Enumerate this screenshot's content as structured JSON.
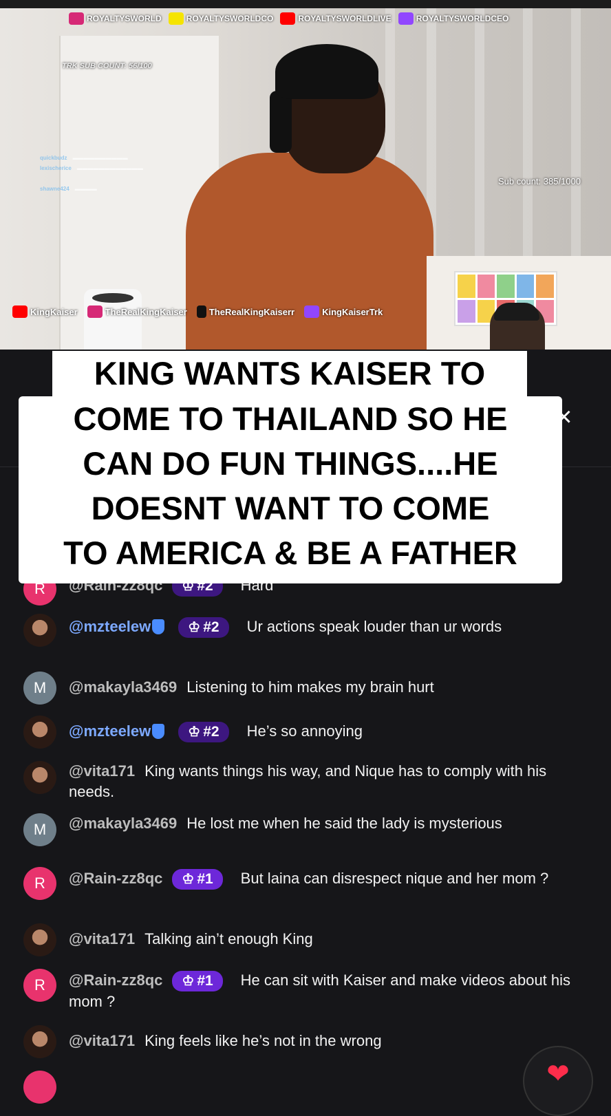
{
  "video": {
    "top_socials": [
      {
        "name": "ROYALTYSWORLD",
        "icon": "instagram-icon",
        "color": "#d62976"
      },
      {
        "name": "ROYALTYSWORLDCO",
        "icon": "snapchat-icon",
        "color": "#f5e400"
      },
      {
        "name": "ROYALTYSWORLDLIVE",
        "icon": "youtube-icon",
        "color": "#ff0000"
      },
      {
        "name": "ROYALTYSWORLDCEO",
        "icon": "twitch-icon",
        "color": "#9146ff"
      }
    ],
    "trk_sub_count": "TRK SUB COUNT: 56/100",
    "sub_count": "Sub count: 385/1000",
    "overlay_chat_users": [
      "quickbudz",
      "lexischerice",
      "shawne424"
    ],
    "bottom_socials": [
      {
        "name": "KingKaiser",
        "icon": "youtube-icon",
        "color": "#ff0000"
      },
      {
        "name": "TheRealKingKaiser",
        "icon": "instagram-icon",
        "color": "#d62976"
      },
      {
        "name": "TheRealKingKaiserr",
        "icon": "tiktok-icon",
        "color": "#000000"
      },
      {
        "name": "KingKaiserTrk",
        "icon": "twitch-icon",
        "color": "#9146ff"
      }
    ]
  },
  "close_icon": "×",
  "caption": {
    "line1": "KING WANTS KAISER TO",
    "lines": [
      "COME TO THAILAND SO HE",
      "CAN DO FUN THINGS....HE",
      "DOESNT WANT TO COME",
      "TO AMERICA & BE A FATHER"
    ]
  },
  "comments": [
    {
      "user": "@Rain-zz8qc",
      "avatar": "R",
      "badge": "#2",
      "text": "Hard"
    },
    {
      "user": "@mzteelew",
      "avatar": "photo",
      "verified": true,
      "badge": "#2",
      "text": "Ur actions speak louder than ur words"
    },
    {
      "user": "@makayla3469",
      "avatar": "M",
      "text": "Listening to him makes my brain hurt"
    },
    {
      "user": "@mzteelew",
      "avatar": "photo",
      "verified": true,
      "badge": "#2",
      "text": "He’s so annoying"
    },
    {
      "user": "@vita171",
      "avatar": "photo",
      "text": "King wants things his way, and Nique has to comply with his needs."
    },
    {
      "user": "@makayla3469",
      "avatar": "M",
      "text": "He lost me when he said the lady is mysterious"
    },
    {
      "user": "@Rain-zz8qc",
      "avatar": "R",
      "badge": "#1",
      "text": "But laina can disrespect nique and her mom ?"
    },
    {
      "user": "@vita171",
      "avatar": "photo",
      "text": "Talking ain’t enough King"
    },
    {
      "user": "@Rain-zz8qc",
      "avatar": "R",
      "badge": "#1",
      "text": "He can sit with Kaiser and make videos about his mom ?"
    },
    {
      "user": "@vita171",
      "avatar": "photo",
      "text": "King feels like he’s not in the wrong"
    }
  ],
  "heart_icon": "❤"
}
